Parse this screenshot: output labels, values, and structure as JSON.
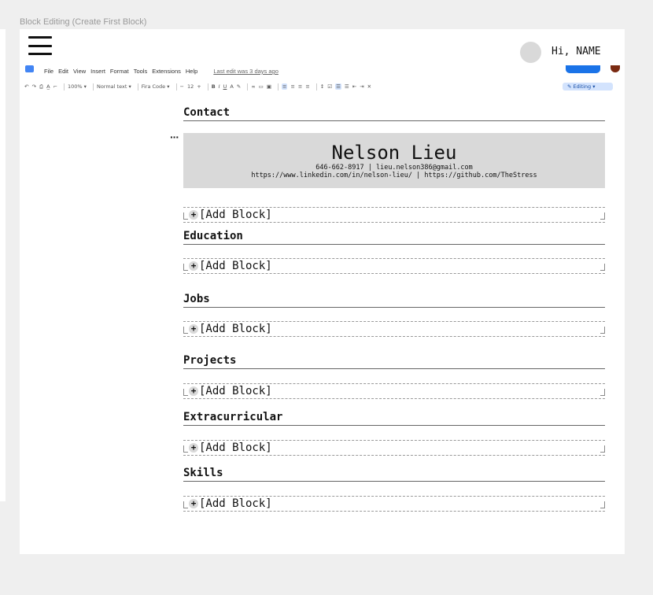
{
  "frame_label": "Block Editing (Create First Block)",
  "topbar": {
    "greeting": "Hi, NAME"
  },
  "gdoc": {
    "menu": [
      "File",
      "Edit",
      "View",
      "Insert",
      "Format",
      "Tools",
      "Extensions",
      "Help"
    ],
    "last_edit": "Last edit was 3 days ago",
    "zoom": "100%",
    "style": "Normal text",
    "font": "Fira Code",
    "font_size": "12",
    "mode": "Editing"
  },
  "resume": {
    "contact_heading": "Contact",
    "name": "Nelson Lieu",
    "contact_line1": "646-662-8917 | lieu.nelson386@gmail.com",
    "contact_line2": "https://www.linkedin.com/in/nelson-lieu/ | https://github.com/TheStress",
    "add_block_label": "[Add Block]",
    "add_icon": "+",
    "sections": [
      "Education",
      "Jobs",
      "Projects",
      "Extracurricular",
      "Skills"
    ]
  }
}
